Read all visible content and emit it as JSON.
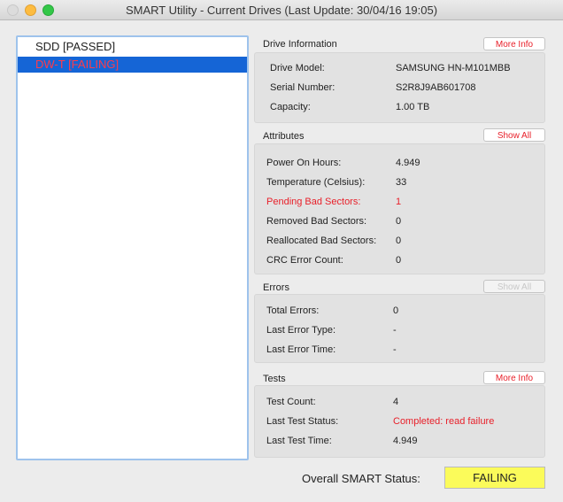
{
  "window": {
    "title": "SMART Utility - Current Drives (Last Update: 30/04/16 19:05)"
  },
  "drives": [
    {
      "label": "SDD  [PASSED]",
      "status": "passed"
    },
    {
      "label": "DW-T  [FAILING]",
      "status": "failing"
    }
  ],
  "drive_info": {
    "title": "Drive Information",
    "button": "More Info",
    "rows": [
      {
        "label": "Drive Model:",
        "value": "SAMSUNG HN-M101MBB"
      },
      {
        "label": "Serial Number:",
        "value": "S2R8J9AB601708"
      },
      {
        "label": "Capacity:",
        "value": "1.00 TB"
      }
    ]
  },
  "attributes": {
    "title": "Attributes",
    "button": "Show All",
    "rows": [
      {
        "label": "Power On Hours:",
        "value": "4.949"
      },
      {
        "label": "Temperature (Celsius):",
        "value": "33"
      },
      {
        "label": "Pending Bad Sectors:",
        "value": "1"
      },
      {
        "label": "Removed Bad Sectors:",
        "value": "0"
      },
      {
        "label": "Reallocated Bad Sectors:",
        "value": "0"
      },
      {
        "label": "CRC Error Count:",
        "value": "0"
      }
    ]
  },
  "errors": {
    "title": "Errors",
    "button": "Show All",
    "rows": [
      {
        "label": "Total Errors:",
        "value": "0"
      },
      {
        "label": "Last Error Type:",
        "value": "-"
      },
      {
        "label": "Last Error Time:",
        "value": "-"
      }
    ]
  },
  "tests": {
    "title": "Tests",
    "button": "More Info",
    "rows": [
      {
        "label": "Test Count:",
        "value": "4"
      },
      {
        "label": "Last Test Status:",
        "value": "Completed: read failure"
      },
      {
        "label": "Last Test Time:",
        "value": "4.949"
      }
    ]
  },
  "overall": {
    "label": "Overall SMART Status:",
    "value": "FAILING"
  },
  "colors": {
    "failing": "#e8202a",
    "selection": "#1565d6",
    "status_bg": "#fbfb5a"
  }
}
